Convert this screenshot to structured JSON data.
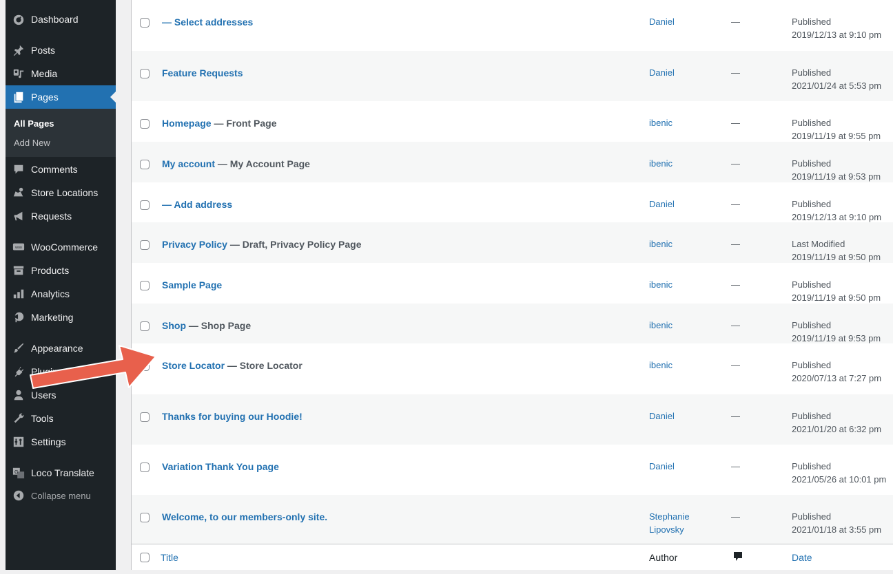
{
  "sidebar": {
    "items": [
      {
        "label": "Dashboard",
        "icon": "dashboard-icon"
      },
      {
        "label": "Posts",
        "icon": "pin-icon"
      },
      {
        "label": "Media",
        "icon": "media-icon"
      },
      {
        "label": "Pages",
        "icon": "pages-icon",
        "active": true
      },
      {
        "label": "Comments",
        "icon": "comment-icon"
      },
      {
        "label": "Store Locations",
        "icon": "store-locations-icon"
      },
      {
        "label": "Requests",
        "icon": "megaphone-icon"
      },
      {
        "label": "WooCommerce",
        "icon": "woo-icon"
      },
      {
        "label": "Products",
        "icon": "archive-icon"
      },
      {
        "label": "Analytics",
        "icon": "bar-chart-icon"
      },
      {
        "label": "Marketing",
        "icon": "marketing-icon"
      },
      {
        "label": "Appearance",
        "icon": "brush-icon"
      },
      {
        "label": "Plugins",
        "icon": "plugin-icon"
      },
      {
        "label": "Users",
        "icon": "user-icon"
      },
      {
        "label": "Tools",
        "icon": "wrench-icon"
      },
      {
        "label": "Settings",
        "icon": "settings-icon"
      },
      {
        "label": "Loco Translate",
        "icon": "translate-icon"
      }
    ],
    "submenu": [
      "All Pages",
      "Add New"
    ],
    "collapse_label": "Collapse menu"
  },
  "rows": [
    {
      "title": "— Select addresses",
      "state": "",
      "author": "Daniel",
      "comments": "—",
      "status": "Published",
      "date": "2019/12/13 at 9:10 pm"
    },
    {
      "title": "Feature Requests",
      "state": "",
      "author": "Daniel",
      "comments": "—",
      "status": "Published",
      "date": "2021/01/24 at 5:53 pm"
    },
    {
      "title": "Homepage",
      "state": " — Front Page",
      "author": "ibenic",
      "comments": "—",
      "status": "Published",
      "date": "2019/11/19 at 9:55 pm"
    },
    {
      "title": "My account",
      "state": " — My Account Page",
      "author": "ibenic",
      "comments": "—",
      "status": "Published",
      "date": "2019/11/19 at 9:53 pm"
    },
    {
      "title": "— Add address",
      "state": "",
      "author": "Daniel",
      "comments": "—",
      "status": "Published",
      "date": "2019/12/13 at 9:10 pm"
    },
    {
      "title": "Privacy Policy",
      "state": " — Draft, Privacy Policy Page",
      "author": "ibenic",
      "comments": "—",
      "status": "Last Modified",
      "date": "2019/11/19 at 9:50 pm"
    },
    {
      "title": "Sample Page",
      "state": "",
      "author": "ibenic",
      "comments": "—",
      "status": "Published",
      "date": "2019/11/19 at 9:50 pm"
    },
    {
      "title": "Shop",
      "state": " — Shop Page",
      "author": "ibenic",
      "comments": "—",
      "status": "Published",
      "date": "2019/11/19 at 9:53 pm"
    },
    {
      "title": "Store Locator",
      "state": " — Store Locator",
      "author": "ibenic",
      "comments": "—",
      "status": "Published",
      "date": "2020/07/13 at 7:27 pm"
    },
    {
      "title": "Thanks for buying our Hoodie!",
      "state": "",
      "author": "Daniel",
      "comments": "—",
      "status": "Published",
      "date": "2021/01/20 at 6:32 pm"
    },
    {
      "title": "Variation Thank You page",
      "state": "",
      "author": "Daniel",
      "comments": "—",
      "status": "Published",
      "date": "2021/05/26 at 10:01 pm"
    },
    {
      "title": "Welcome, to our members-only site.",
      "state": "",
      "author": "Stephanie Lipovsky",
      "comments": "—",
      "status": "Published",
      "date": "2021/01/18 at 3:55 pm"
    }
  ],
  "footer": {
    "title_label": "Title",
    "author_label": "Author",
    "date_label": "Date"
  },
  "colors": {
    "sidebar_bg": "#1d2327",
    "active": "#2271b1",
    "link": "#2271b1",
    "arrow": "#e8604c"
  }
}
